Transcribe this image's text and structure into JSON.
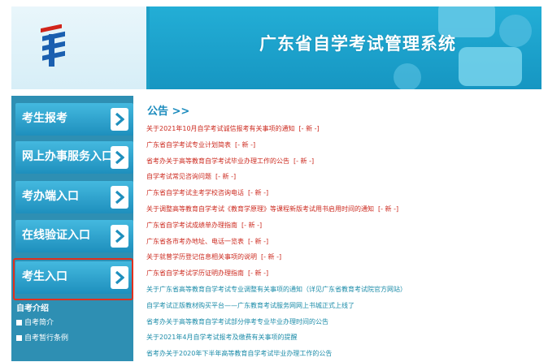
{
  "header": {
    "title": "广东省自学考试管理系统"
  },
  "sidebar": {
    "buttons": [
      {
        "label": "考生报考"
      },
      {
        "label": "网上办事服务入口"
      },
      {
        "label": "考办端入口"
      },
      {
        "label": "在线验证入口"
      },
      {
        "label": "考生入口"
      }
    ],
    "section_title": "自考介绍",
    "links": [
      {
        "label": "自考简介"
      },
      {
        "label": "自考暂行条例"
      }
    ]
  },
  "main": {
    "announce_title": "公告 >>",
    "new_tag": "[- 新 -]",
    "news": [
      {
        "text": "关于2021年10月自学考试诚信报考有关事项的通知",
        "is_new": true,
        "color": "red"
      },
      {
        "text": "广东省自学考试专业计划简表",
        "is_new": true,
        "color": "red"
      },
      {
        "text": "省考办关于高等教育自学考试毕业办理工作的公告",
        "is_new": true,
        "color": "red"
      },
      {
        "text": "自学考试常见咨询问题",
        "is_new": true,
        "color": "red"
      },
      {
        "text": "广东省自学考试主考学校咨询电话",
        "is_new": true,
        "color": "red"
      },
      {
        "text": "关于调整高等教育自学考试《教育学原理》等课程新版考试用书启用时间的通知",
        "is_new": true,
        "color": "red"
      },
      {
        "text": "广东省自学考试成绩单办理指南",
        "is_new": true,
        "color": "red"
      },
      {
        "text": "广东省各市考办地址、电话一览表",
        "is_new": true,
        "color": "red"
      },
      {
        "text": "关于就曾学历登记信息相关事项的说明",
        "is_new": true,
        "color": "red"
      },
      {
        "text": "广东省自学考试学历证明办理指南",
        "is_new": true,
        "color": "red"
      },
      {
        "text": "关于广东省高等教育自学考试专业调整有关事项的通知（详见广东省教育考试院官方网站）",
        "is_new": false,
        "color": "teal"
      },
      {
        "text": "自学考试正版教材购买平台——广东教育考试服务网网上书城正式上线了",
        "is_new": false,
        "color": "teal"
      },
      {
        "text": "省考办关于高等教育自学考试部分停考专业毕业办理时间的公告",
        "is_new": false,
        "color": "teal"
      },
      {
        "text": "关于2021年4月自学考试报考及缴费有关事项的提醒",
        "is_new": false,
        "color": "teal"
      },
      {
        "text": "省考办关于2020年下半年高等教育自学考试毕业办理工作的公告",
        "is_new": false,
        "color": "teal"
      }
    ]
  },
  "colors": {
    "accent": "#1d9fc6",
    "sidebar": "#2e8fb3",
    "news_red": "#cc2a1f",
    "news_teal": "#1c8ca9",
    "highlight": "#e0301e"
  }
}
